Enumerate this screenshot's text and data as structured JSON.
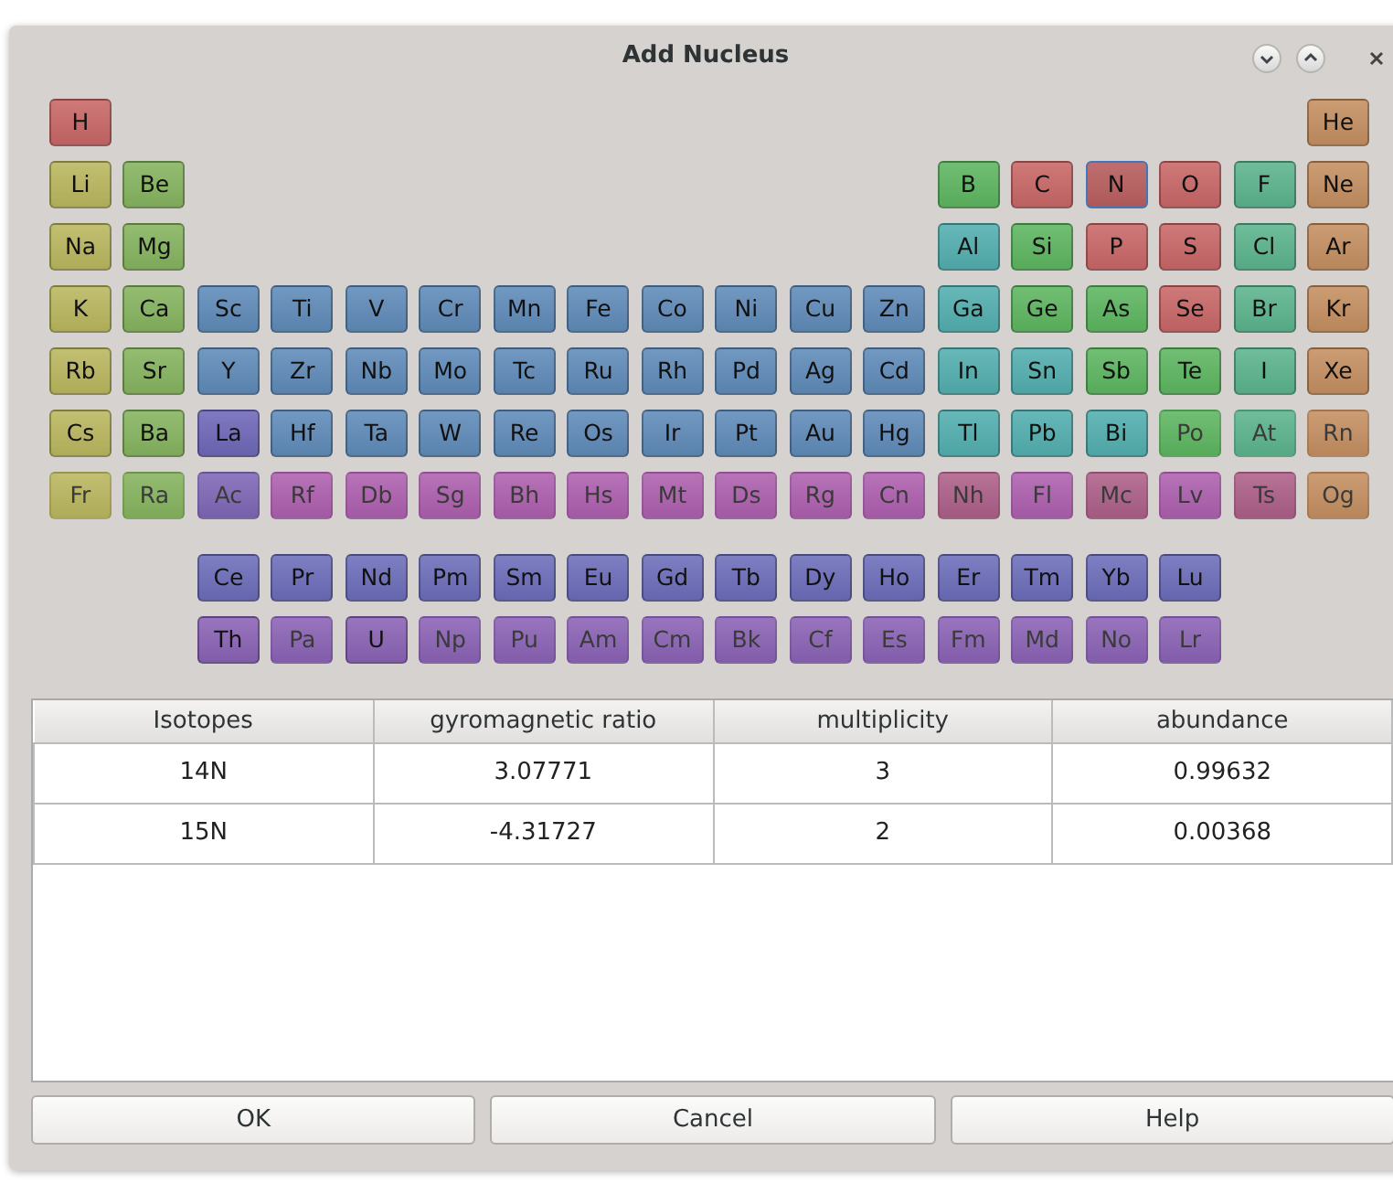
{
  "window": {
    "title": "Add Nucleus"
  },
  "periodic_table": {
    "rows": [
      [
        {
          "symbol": "H",
          "color": "#c86666",
          "disabled": false,
          "selected": false
        },
        "",
        "",
        "",
        "",
        "",
        "",
        "",
        "",
        "",
        "",
        "",
        "",
        "",
        "",
        "",
        "",
        {
          "symbol": "He",
          "color": "#c48e60",
          "disabled": false,
          "selected": false
        }
      ],
      [
        {
          "symbol": "Li",
          "color": "#b9b65e",
          "disabled": false,
          "selected": false
        },
        {
          "symbol": "Be",
          "color": "#85b35e",
          "disabled": false,
          "selected": false
        },
        "",
        "",
        "",
        "",
        "",
        "",
        "",
        "",
        "",
        "",
        {
          "symbol": "B",
          "color": "#5db560",
          "disabled": false,
          "selected": false
        },
        {
          "symbol": "C",
          "color": "#c86666",
          "disabled": false,
          "selected": false
        },
        {
          "symbol": "N",
          "color": "#c86666",
          "disabled": false,
          "selected": true
        },
        {
          "symbol": "O",
          "color": "#c86666",
          "disabled": false,
          "selected": false
        },
        {
          "symbol": "F",
          "color": "#5bb38c",
          "disabled": false,
          "selected": false
        },
        {
          "symbol": "Ne",
          "color": "#c48e60",
          "disabled": false,
          "selected": false
        }
      ],
      [
        {
          "symbol": "Na",
          "color": "#b9b65e",
          "disabled": false,
          "selected": false
        },
        {
          "symbol": "Mg",
          "color": "#85b35e",
          "disabled": false,
          "selected": false
        },
        "",
        "",
        "",
        "",
        "",
        "",
        "",
        "",
        "",
        "",
        {
          "symbol": "Al",
          "color": "#52aeae",
          "disabled": false,
          "selected": false
        },
        {
          "symbol": "Si",
          "color": "#5db560",
          "disabled": false,
          "selected": false
        },
        {
          "symbol": "P",
          "color": "#c86666",
          "disabled": false,
          "selected": false
        },
        {
          "symbol": "S",
          "color": "#c86666",
          "disabled": false,
          "selected": false
        },
        {
          "symbol": "Cl",
          "color": "#5bb38c",
          "disabled": false,
          "selected": false
        },
        {
          "symbol": "Ar",
          "color": "#c48e60",
          "disabled": false,
          "selected": false
        }
      ],
      [
        {
          "symbol": "K",
          "color": "#b9b65e",
          "disabled": false,
          "selected": false
        },
        {
          "symbol": "Ca",
          "color": "#85b35e",
          "disabled": false,
          "selected": false
        },
        {
          "symbol": "Sc",
          "color": "#5e8ab8",
          "disabled": false,
          "selected": false
        },
        {
          "symbol": "Ti",
          "color": "#5e8ab8",
          "disabled": false,
          "selected": false
        },
        {
          "symbol": "V",
          "color": "#5e8ab8",
          "disabled": false,
          "selected": false
        },
        {
          "symbol": "Cr",
          "color": "#5e8ab8",
          "disabled": false,
          "selected": false
        },
        {
          "symbol": "Mn",
          "color": "#5e8ab8",
          "disabled": false,
          "selected": false
        },
        {
          "symbol": "Fe",
          "color": "#5e8ab8",
          "disabled": false,
          "selected": false
        },
        {
          "symbol": "Co",
          "color": "#5e8ab8",
          "disabled": false,
          "selected": false
        },
        {
          "symbol": "Ni",
          "color": "#5e8ab8",
          "disabled": false,
          "selected": false
        },
        {
          "symbol": "Cu",
          "color": "#5e8ab8",
          "disabled": false,
          "selected": false
        },
        {
          "symbol": "Zn",
          "color": "#5e8ab8",
          "disabled": false,
          "selected": false
        },
        {
          "symbol": "Ga",
          "color": "#52aeae",
          "disabled": false,
          "selected": false
        },
        {
          "symbol": "Ge",
          "color": "#5db560",
          "disabled": false,
          "selected": false
        },
        {
          "symbol": "As",
          "color": "#5db560",
          "disabled": false,
          "selected": false
        },
        {
          "symbol": "Se",
          "color": "#c86666",
          "disabled": false,
          "selected": false
        },
        {
          "symbol": "Br",
          "color": "#5bb38c",
          "disabled": false,
          "selected": false
        },
        {
          "symbol": "Kr",
          "color": "#c48e60",
          "disabled": false,
          "selected": false
        }
      ],
      [
        {
          "symbol": "Rb",
          "color": "#b9b65e",
          "disabled": false,
          "selected": false
        },
        {
          "symbol": "Sr",
          "color": "#85b35e",
          "disabled": false,
          "selected": false
        },
        {
          "symbol": "Y",
          "color": "#5e8ab8",
          "disabled": false,
          "selected": false
        },
        {
          "symbol": "Zr",
          "color": "#5e8ab8",
          "disabled": false,
          "selected": false
        },
        {
          "symbol": "Nb",
          "color": "#5e8ab8",
          "disabled": false,
          "selected": false
        },
        {
          "symbol": "Mo",
          "color": "#5e8ab8",
          "disabled": false,
          "selected": false
        },
        {
          "symbol": "Tc",
          "color": "#5e8ab8",
          "disabled": false,
          "selected": false
        },
        {
          "symbol": "Ru",
          "color": "#5e8ab8",
          "disabled": false,
          "selected": false
        },
        {
          "symbol": "Rh",
          "color": "#5e8ab8",
          "disabled": false,
          "selected": false
        },
        {
          "symbol": "Pd",
          "color": "#5e8ab8",
          "disabled": false,
          "selected": false
        },
        {
          "symbol": "Ag",
          "color": "#5e8ab8",
          "disabled": false,
          "selected": false
        },
        {
          "symbol": "Cd",
          "color": "#5e8ab8",
          "disabled": false,
          "selected": false
        },
        {
          "symbol": "In",
          "color": "#52aeae",
          "disabled": false,
          "selected": false
        },
        {
          "symbol": "Sn",
          "color": "#52aeae",
          "disabled": false,
          "selected": false
        },
        {
          "symbol": "Sb",
          "color": "#5db560",
          "disabled": false,
          "selected": false
        },
        {
          "symbol": "Te",
          "color": "#5db560",
          "disabled": false,
          "selected": false
        },
        {
          "symbol": "I",
          "color": "#5bb38c",
          "disabled": false,
          "selected": false
        },
        {
          "symbol": "Xe",
          "color": "#c48e60",
          "disabled": false,
          "selected": false
        }
      ],
      [
        {
          "symbol": "Cs",
          "color": "#b9b65e",
          "disabled": false,
          "selected": false
        },
        {
          "symbol": "Ba",
          "color": "#85b35e",
          "disabled": false,
          "selected": false
        },
        {
          "symbol": "La",
          "color": "#6e67b8",
          "disabled": false,
          "selected": false
        },
        {
          "symbol": "Hf",
          "color": "#5e8ab8",
          "disabled": false,
          "selected": false
        },
        {
          "symbol": "Ta",
          "color": "#5e8ab8",
          "disabled": false,
          "selected": false
        },
        {
          "symbol": "W",
          "color": "#5e8ab8",
          "disabled": false,
          "selected": false
        },
        {
          "symbol": "Re",
          "color": "#5e8ab8",
          "disabled": false,
          "selected": false
        },
        {
          "symbol": "Os",
          "color": "#5e8ab8",
          "disabled": false,
          "selected": false
        },
        {
          "symbol": "Ir",
          "color": "#5e8ab8",
          "disabled": false,
          "selected": false
        },
        {
          "symbol": "Pt",
          "color": "#5e8ab8",
          "disabled": false,
          "selected": false
        },
        {
          "symbol": "Au",
          "color": "#5e8ab8",
          "disabled": false,
          "selected": false
        },
        {
          "symbol": "Hg",
          "color": "#5e8ab8",
          "disabled": false,
          "selected": false
        },
        {
          "symbol": "Tl",
          "color": "#52aeae",
          "disabled": false,
          "selected": false
        },
        {
          "symbol": "Pb",
          "color": "#52aeae",
          "disabled": false,
          "selected": false
        },
        {
          "symbol": "Bi",
          "color": "#52aeae",
          "disabled": false,
          "selected": false
        },
        {
          "symbol": "Po",
          "color": "#5db560",
          "disabled": true,
          "selected": false
        },
        {
          "symbol": "At",
          "color": "#5bb38c",
          "disabled": true,
          "selected": false
        },
        {
          "symbol": "Rn",
          "color": "#c48e60",
          "disabled": true,
          "selected": false
        }
      ],
      [
        {
          "symbol": "Fr",
          "color": "#b9b65e",
          "disabled": true,
          "selected": false
        },
        {
          "symbol": "Ra",
          "color": "#85b35e",
          "disabled": true,
          "selected": false
        },
        {
          "symbol": "Ac",
          "color": "#7e66b5",
          "disabled": true,
          "selected": false
        },
        {
          "symbol": "Rf",
          "color": "#ad5fae",
          "disabled": true,
          "selected": false
        },
        {
          "symbol": "Db",
          "color": "#ad5fae",
          "disabled": true,
          "selected": false
        },
        {
          "symbol": "Sg",
          "color": "#ad5fae",
          "disabled": true,
          "selected": false
        },
        {
          "symbol": "Bh",
          "color": "#ad5fae",
          "disabled": true,
          "selected": false
        },
        {
          "symbol": "Hs",
          "color": "#ad5fae",
          "disabled": true,
          "selected": false
        },
        {
          "symbol": "Mt",
          "color": "#ad5fae",
          "disabled": true,
          "selected": false
        },
        {
          "symbol": "Ds",
          "color": "#ad5fae",
          "disabled": true,
          "selected": false
        },
        {
          "symbol": "Rg",
          "color": "#ad5fae",
          "disabled": true,
          "selected": false
        },
        {
          "symbol": "Cn",
          "color": "#ad5fae",
          "disabled": true,
          "selected": false
        },
        {
          "symbol": "Nh",
          "color": "#ad5f88",
          "disabled": true,
          "selected": false
        },
        {
          "symbol": "Fl",
          "color": "#ad5fae",
          "disabled": true,
          "selected": false
        },
        {
          "symbol": "Mc",
          "color": "#ad5f88",
          "disabled": true,
          "selected": false
        },
        {
          "symbol": "Lv",
          "color": "#ad5fae",
          "disabled": true,
          "selected": false
        },
        {
          "symbol": "Ts",
          "color": "#ad5f88",
          "disabled": true,
          "selected": false
        },
        {
          "symbol": "Og",
          "color": "#c48e60",
          "disabled": true,
          "selected": false
        }
      ]
    ],
    "f_rows": [
      [
        "",
        "",
        {
          "symbol": "Ce",
          "color": "#6c6cba",
          "disabled": false,
          "selected": false
        },
        {
          "symbol": "Pr",
          "color": "#6c6cba",
          "disabled": false,
          "selected": false
        },
        {
          "symbol": "Nd",
          "color": "#6c6cba",
          "disabled": false,
          "selected": false
        },
        {
          "symbol": "Pm",
          "color": "#6c6cba",
          "disabled": false,
          "selected": false
        },
        {
          "symbol": "Sm",
          "color": "#6c6cba",
          "disabled": false,
          "selected": false
        },
        {
          "symbol": "Eu",
          "color": "#6c6cba",
          "disabled": false,
          "selected": false
        },
        {
          "symbol": "Gd",
          "color": "#6c6cba",
          "disabled": false,
          "selected": false
        },
        {
          "symbol": "Tb",
          "color": "#6c6cba",
          "disabled": false,
          "selected": false
        },
        {
          "symbol": "Dy",
          "color": "#6c6cba",
          "disabled": false,
          "selected": false
        },
        {
          "symbol": "Ho",
          "color": "#6c6cba",
          "disabled": false,
          "selected": false
        },
        {
          "symbol": "Er",
          "color": "#6c6cba",
          "disabled": false,
          "selected": false
        },
        {
          "symbol": "Tm",
          "color": "#6c6cba",
          "disabled": false,
          "selected": false
        },
        {
          "symbol": "Yb",
          "color": "#6c6cba",
          "disabled": false,
          "selected": false
        },
        {
          "symbol": "Lu",
          "color": "#6c6cba",
          "disabled": false,
          "selected": false
        }
      ],
      [
        "",
        "",
        {
          "symbol": "Th",
          "color": "#8a62b5",
          "disabled": false,
          "selected": false
        },
        {
          "symbol": "Pa",
          "color": "#8a62b5",
          "disabled": true,
          "selected": false
        },
        {
          "symbol": "U",
          "color": "#8a62b5",
          "disabled": false,
          "selected": false
        },
        {
          "symbol": "Np",
          "color": "#8a62b5",
          "disabled": true,
          "selected": false
        },
        {
          "symbol": "Pu",
          "color": "#8a62b5",
          "disabled": true,
          "selected": false
        },
        {
          "symbol": "Am",
          "color": "#8a62b5",
          "disabled": true,
          "selected": false
        },
        {
          "symbol": "Cm",
          "color": "#8a62b5",
          "disabled": true,
          "selected": false
        },
        {
          "symbol": "Bk",
          "color": "#8a62b5",
          "disabled": true,
          "selected": false
        },
        {
          "symbol": "Cf",
          "color": "#8a62b5",
          "disabled": true,
          "selected": false
        },
        {
          "symbol": "Es",
          "color": "#8a62b5",
          "disabled": true,
          "selected": false
        },
        {
          "symbol": "Fm",
          "color": "#8a62b5",
          "disabled": true,
          "selected": false
        },
        {
          "symbol": "Md",
          "color": "#8a62b5",
          "disabled": true,
          "selected": false
        },
        {
          "symbol": "No",
          "color": "#8a62b5",
          "disabled": true,
          "selected": false
        },
        {
          "symbol": "Lr",
          "color": "#8a62b5",
          "disabled": true,
          "selected": false
        }
      ]
    ]
  },
  "table": {
    "columns": [
      "Isotopes",
      "gyromagnetic ratio",
      "multiplicity",
      "abundance"
    ],
    "rows": [
      [
        "14N",
        "3.07771",
        "3",
        "0.99632"
      ],
      [
        "15N",
        "-4.31727",
        "2",
        "0.00368"
      ]
    ]
  },
  "buttons": [
    "OK",
    "Cancel",
    "Help"
  ]
}
